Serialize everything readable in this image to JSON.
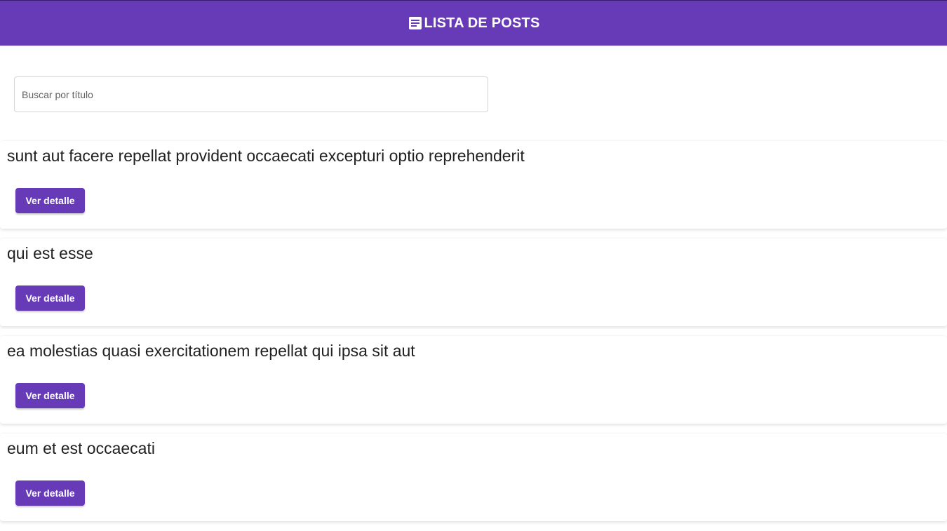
{
  "header": {
    "title": "LISTA DE POSTS",
    "icon": "article-icon",
    "background": "#673ab7"
  },
  "search": {
    "placeholder": "Buscar por título",
    "value": ""
  },
  "posts": [
    {
      "title": "sunt aut facere repellat provident occaecati excepturi optio reprehenderit",
      "button_label": "Ver detalle"
    },
    {
      "title": "qui est esse",
      "button_label": "Ver detalle"
    },
    {
      "title": "ea molestias quasi exercitationem repellat qui ipsa sit aut",
      "button_label": "Ver detalle"
    },
    {
      "title": "eum et est occaecati",
      "button_label": "Ver detalle"
    }
  ],
  "colors": {
    "accent": "#673ab7",
    "text": "#212121"
  }
}
